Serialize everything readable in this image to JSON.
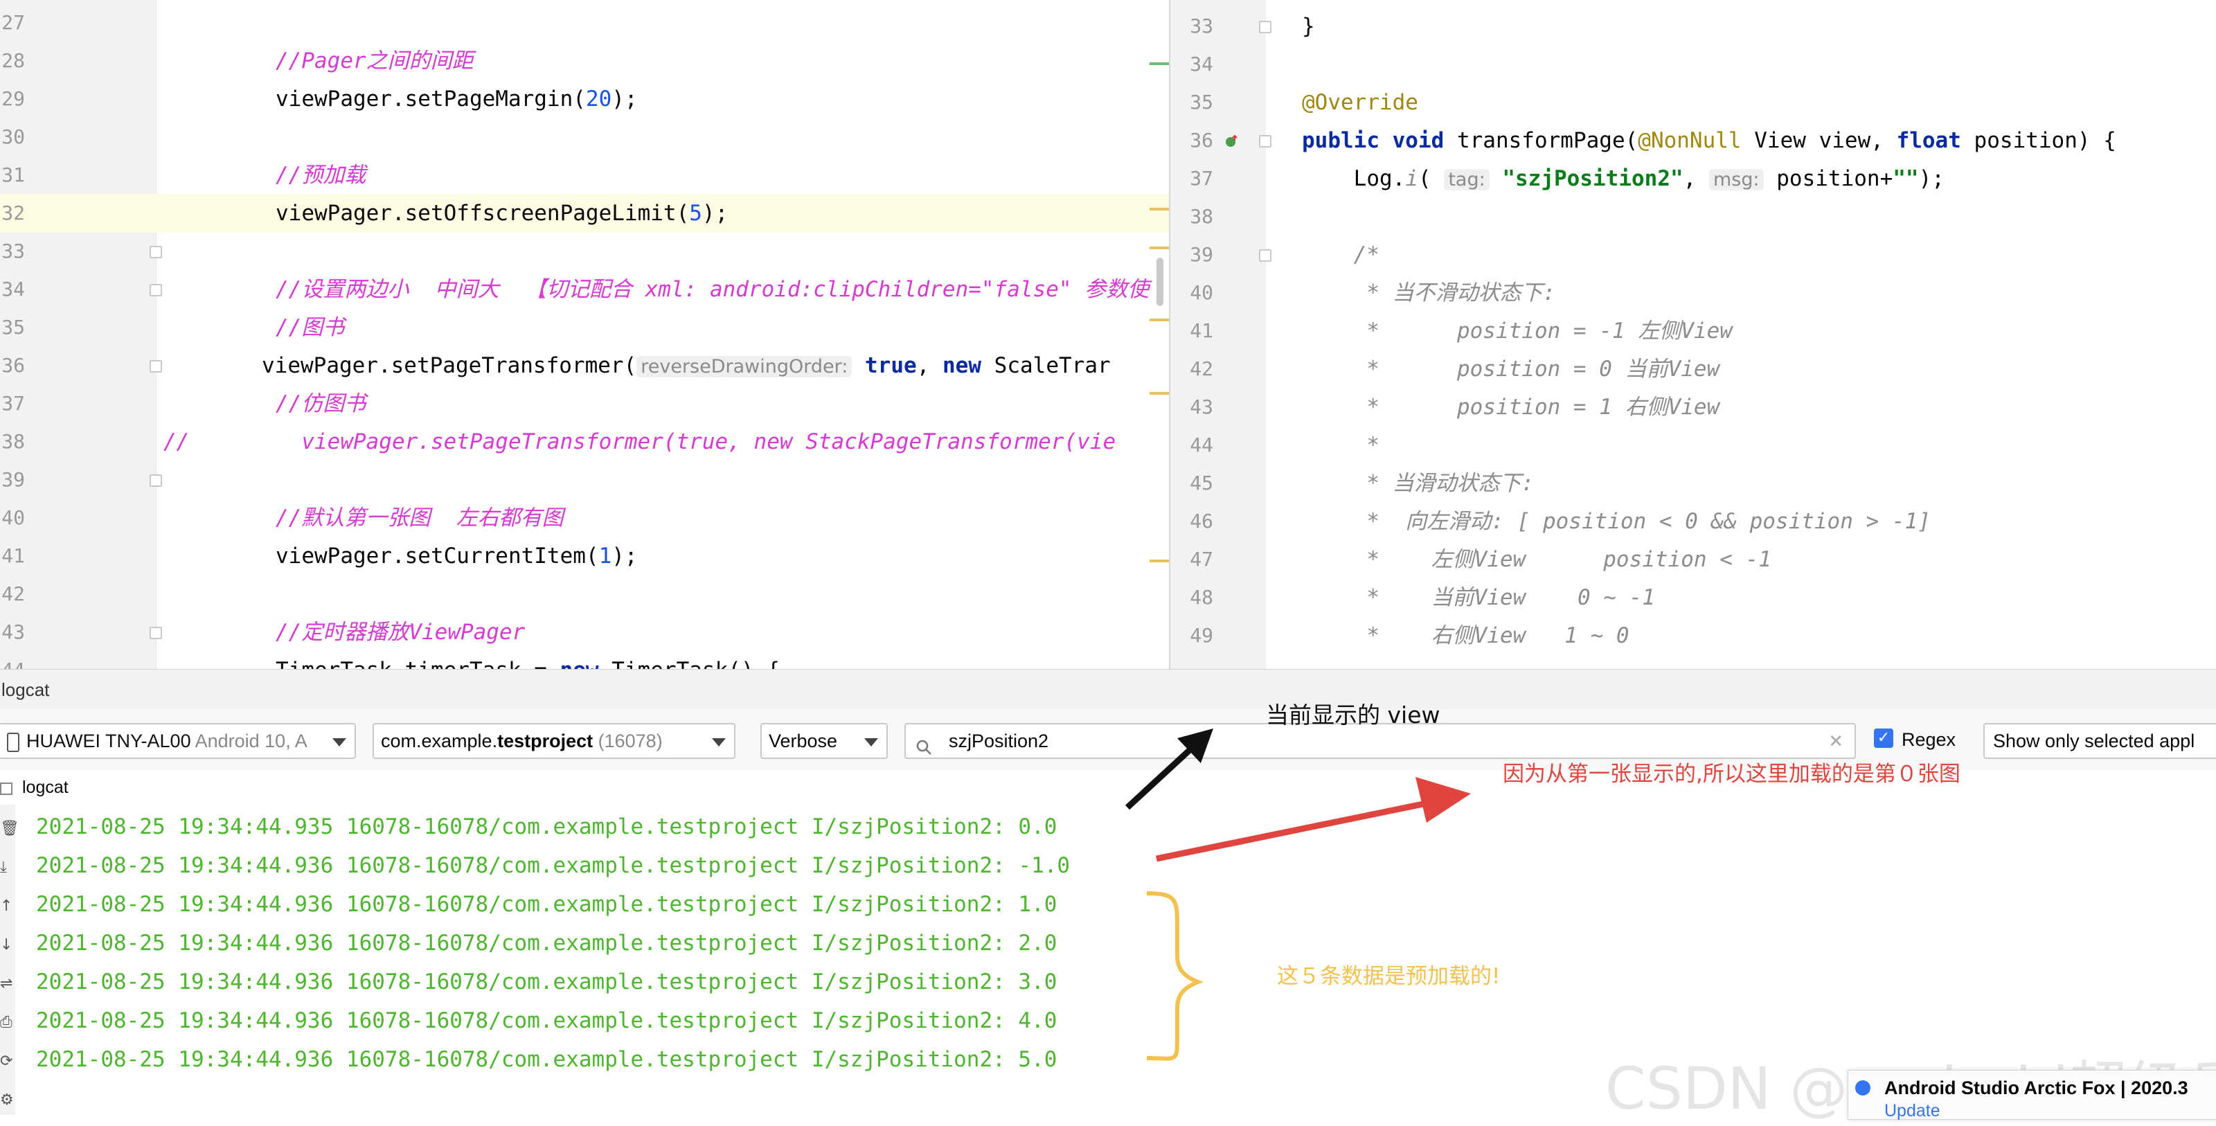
{
  "editor_left": {
    "lines": [
      {
        "num": "27",
        "parts": []
      },
      {
        "num": "28",
        "parts": [
          {
            "cls": "cmi",
            "t": "//Pager之间的间距"
          }
        ]
      },
      {
        "num": "29",
        "parts": [
          {
            "cls": "",
            "t": "viewPager.setPageMargin("
          },
          {
            "cls": "num",
            "t": "20"
          },
          {
            "cls": "",
            "t": ");"
          }
        ]
      },
      {
        "num": "30",
        "parts": []
      },
      {
        "num": "31",
        "parts": [
          {
            "cls": "cmi",
            "t": "//预加载"
          }
        ]
      },
      {
        "num": "32",
        "parts": [
          {
            "cls": "",
            "t": "viewPager.setOffscreenPageLimit("
          },
          {
            "cls": "num",
            "t": "5"
          },
          {
            "cls": "",
            "t": ");"
          }
        ]
      },
      {
        "num": "33",
        "parts": []
      },
      {
        "num": "34",
        "parts": [
          {
            "cls": "cmi",
            "t": "//设置两边小  中间大  【切记配合 xml: android:clipChildren=\"false\" 参数使"
          }
        ]
      },
      {
        "num": "35",
        "parts": [
          {
            "cls": "cmi",
            "t": "//图书"
          }
        ]
      },
      {
        "num": "36",
        "parts": [
          {
            "cls": "",
            "t": "viewPager.setPageTransformer("
          },
          {
            "cls": "hint",
            "t": "reverseDrawingOrder:"
          },
          {
            "cls": "kw",
            "t": " true"
          },
          {
            "cls": "",
            "t": ", "
          },
          {
            "cls": "kw",
            "t": "new"
          },
          {
            "cls": "",
            "t": " ScaleTrar"
          }
        ]
      },
      {
        "num": "37",
        "parts": [
          {
            "cls": "cmi",
            "t": "//仿图书"
          }
        ]
      },
      {
        "num": "38",
        "parts": [
          {
            "cls": "cmi",
            "t": "  viewPager.setPageTransformer(true, new StackPageTransformer(vie"
          }
        ]
      },
      {
        "num": "39",
        "parts": []
      },
      {
        "num": "40",
        "parts": [
          {
            "cls": "cmi",
            "t": "//默认第一张图  左右都有图"
          }
        ]
      },
      {
        "num": "41",
        "parts": [
          {
            "cls": "",
            "t": "viewPager.setCurrentItem("
          },
          {
            "cls": "num",
            "t": "1"
          },
          {
            "cls": "",
            "t": ");"
          }
        ]
      },
      {
        "num": "42",
        "parts": []
      },
      {
        "num": "43",
        "parts": [
          {
            "cls": "cmi",
            "t": "//定时器播放ViewPager"
          }
        ]
      },
      {
        "num": "44",
        "parts": [
          {
            "cls": "",
            "t": "TimerTask timerTask = "
          },
          {
            "cls": "kw",
            "t": "new"
          },
          {
            "cls": "",
            "t": " TimerTask() {"
          }
        ]
      }
    ],
    "comment_prefix_38": "//"
  },
  "editor_right": {
    "lines": [
      {
        "num": "33",
        "parts": [
          {
            "cls": "",
            "t": "}"
          }
        ]
      },
      {
        "num": "34",
        "parts": []
      },
      {
        "num": "35",
        "parts": [
          {
            "cls": "ann",
            "t": "@Override"
          }
        ]
      },
      {
        "num": "36",
        "parts": [
          {
            "cls": "kw",
            "t": "public void"
          },
          {
            "cls": "",
            "t": " transformPage("
          },
          {
            "cls": "ann",
            "t": "@NonNull"
          },
          {
            "cls": "",
            "t": " View view, "
          },
          {
            "cls": "kw",
            "t": "float"
          },
          {
            "cls": "",
            "t": " position) {"
          }
        ]
      },
      {
        "num": "37",
        "parts": [
          {
            "cls": "",
            "t": "    Log."
          },
          {
            "cls": "dc",
            "t": "i"
          },
          {
            "cls": "",
            "t": "( "
          },
          {
            "cls": "hint",
            "t": "tag:"
          },
          {
            "cls": "str",
            "t": " \"szjPosition2\""
          },
          {
            "cls": "",
            "t": ", "
          },
          {
            "cls": "hint",
            "t": "msg:"
          },
          {
            "cls": "",
            "t": " position+"
          },
          {
            "cls": "str",
            "t": "\"\""
          },
          {
            "cls": "",
            "t": ");"
          }
        ]
      },
      {
        "num": "38",
        "parts": []
      },
      {
        "num": "39",
        "parts": [
          {
            "cls": "dc",
            "t": "    /*"
          }
        ]
      },
      {
        "num": "40",
        "parts": [
          {
            "cls": "dc",
            "t": "     * 当不滑动状态下:"
          }
        ]
      },
      {
        "num": "41",
        "parts": [
          {
            "cls": "dc",
            "t": "     *      position = -1 左侧View"
          }
        ]
      },
      {
        "num": "42",
        "parts": [
          {
            "cls": "dc",
            "t": "     *      position = 0 当前View"
          }
        ]
      },
      {
        "num": "43",
        "parts": [
          {
            "cls": "dc",
            "t": "     *      position = 1 右侧View"
          }
        ]
      },
      {
        "num": "44",
        "parts": [
          {
            "cls": "dc",
            "t": "     *"
          }
        ]
      },
      {
        "num": "45",
        "parts": [
          {
            "cls": "dc",
            "t": "     * 当滑动状态下:"
          }
        ]
      },
      {
        "num": "46",
        "parts": [
          {
            "cls": "dc",
            "t": "     *  向左滑动: [ position < 0 && position > -1]"
          }
        ]
      },
      {
        "num": "47",
        "parts": [
          {
            "cls": "dc",
            "t": "     *    左侧View      position < -1"
          }
        ]
      },
      {
        "num": "48",
        "parts": [
          {
            "cls": "dc",
            "t": "     *    当前View    0 ~ -1"
          }
        ]
      },
      {
        "num": "49",
        "parts": [
          {
            "cls": "dc",
            "t": "     *    右侧View   1 ~ 0"
          }
        ]
      }
    ]
  },
  "logcat": {
    "panel_title": "logcat",
    "device": {
      "name": "HUAWEI TNY-AL00",
      "detail": " Android 10, A"
    },
    "process": {
      "name_prefix": "com.example.",
      "name_bold": "testproject",
      "pid": " (16078)"
    },
    "level": "Verbose",
    "search_value": "szjPosition2",
    "regex_label": "Regex",
    "regex_checked": true,
    "filter_option": "Show only selected appl",
    "tab_label": "logcat",
    "entries": [
      "2021-08-25 19:34:44.935 16078-16078/com.example.testproject I/szjPosition2: 0.0",
      "2021-08-25 19:34:44.936 16078-16078/com.example.testproject I/szjPosition2: -1.0",
      "2021-08-25 19:34:44.936 16078-16078/com.example.testproject I/szjPosition2: 1.0",
      "2021-08-25 19:34:44.936 16078-16078/com.example.testproject I/szjPosition2: 2.0",
      "2021-08-25 19:34:44.936 16078-16078/com.example.testproject I/szjPosition2: 3.0",
      "2021-08-25 19:34:44.936 16078-16078/com.example.testproject I/szjPosition2: 4.0",
      "2021-08-25 19:34:44.936 16078-16078/com.example.testproject I/szjPosition2: 5.0"
    ]
  },
  "annotations": {
    "current_view": "当前显示的 view",
    "first_loaded": "因为从第一张显示的,所以这里加载的是第０张图",
    "preloaded": "这５条数据是预加载的!"
  },
  "notification": {
    "title": "Android Studio Arctic Fox | 2020.3",
    "link": "Update"
  },
  "watermark": "CSDN @android超级兵"
}
